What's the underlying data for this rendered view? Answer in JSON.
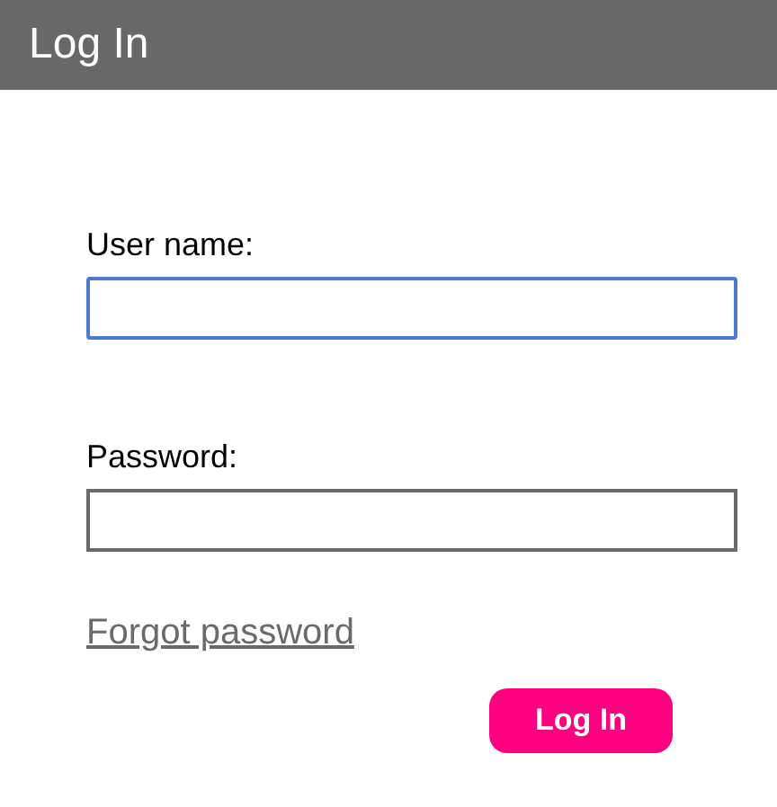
{
  "header": {
    "title": "Log In"
  },
  "fields": [
    {
      "label": "User name:",
      "focused": true
    },
    {
      "label": "Password:",
      "focused": false
    }
  ],
  "forgot_link": "Forgot password",
  "button": "Log In"
}
